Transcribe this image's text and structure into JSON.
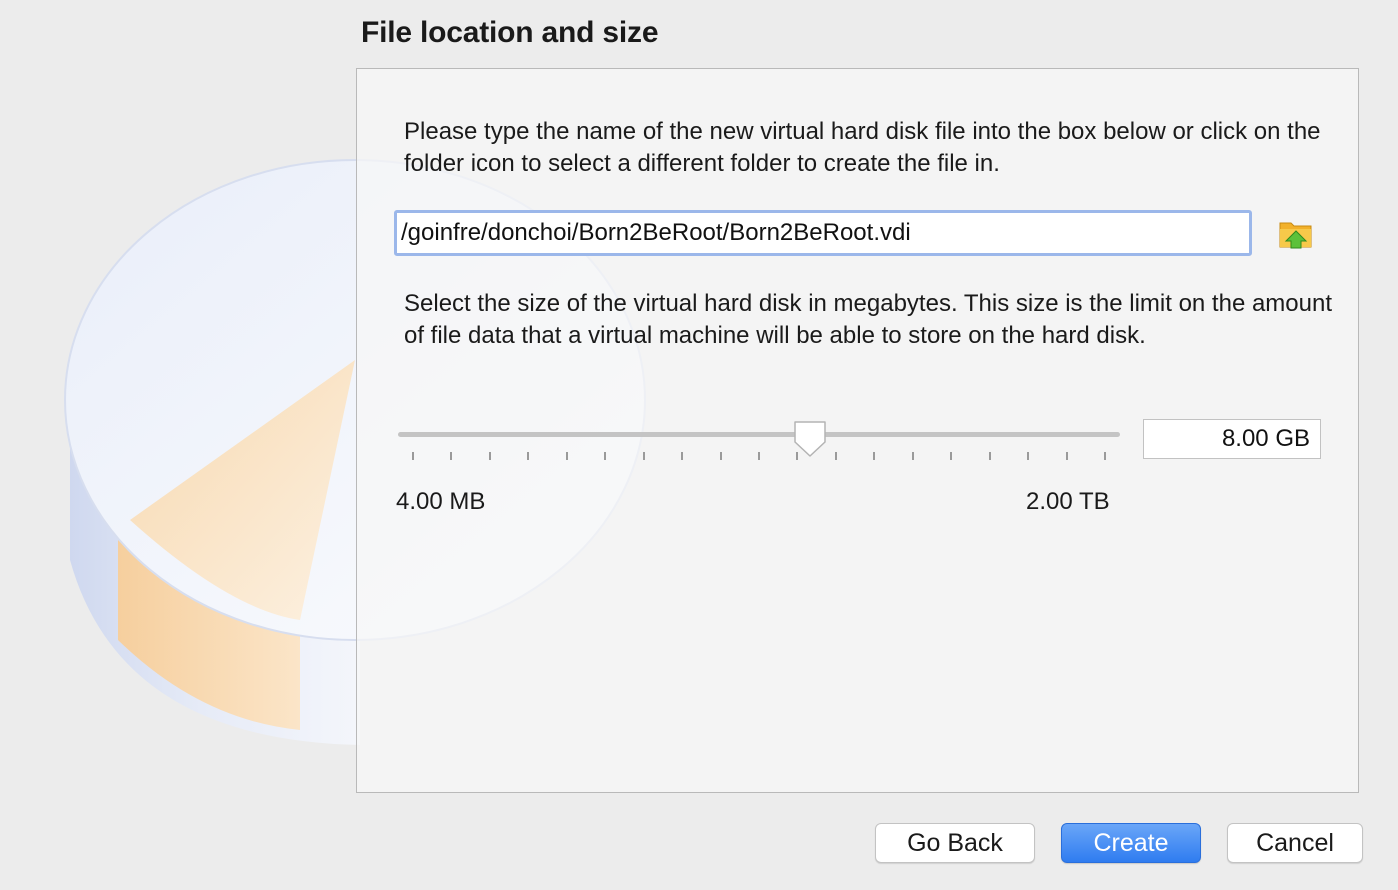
{
  "header": {
    "title": "File location and size"
  },
  "location": {
    "instructions": "Please type the name of the new virtual hard disk file into the box below or click on the folder icon to select a different folder to create the file in.",
    "path_value": "/goinfre/donchoi/Born2BeRoot/Born2BeRoot.vdi",
    "folder_icon": "folder-icon"
  },
  "size": {
    "instructions": "Select the size of the virtual hard disk in megabytes. This size is the limit on the amount of file data that a virtual machine will be able to store on the hard disk.",
    "value": "8.00 GB",
    "min_label": "4.00 MB",
    "max_label": "2.00 TB",
    "slider_fraction": 0.57
  },
  "buttons": {
    "back": "Go Back",
    "create": "Create",
    "cancel": "Cancel"
  },
  "colors": {
    "accent": "#2f7cf0",
    "focus_ring": "#9bb7ea"
  }
}
